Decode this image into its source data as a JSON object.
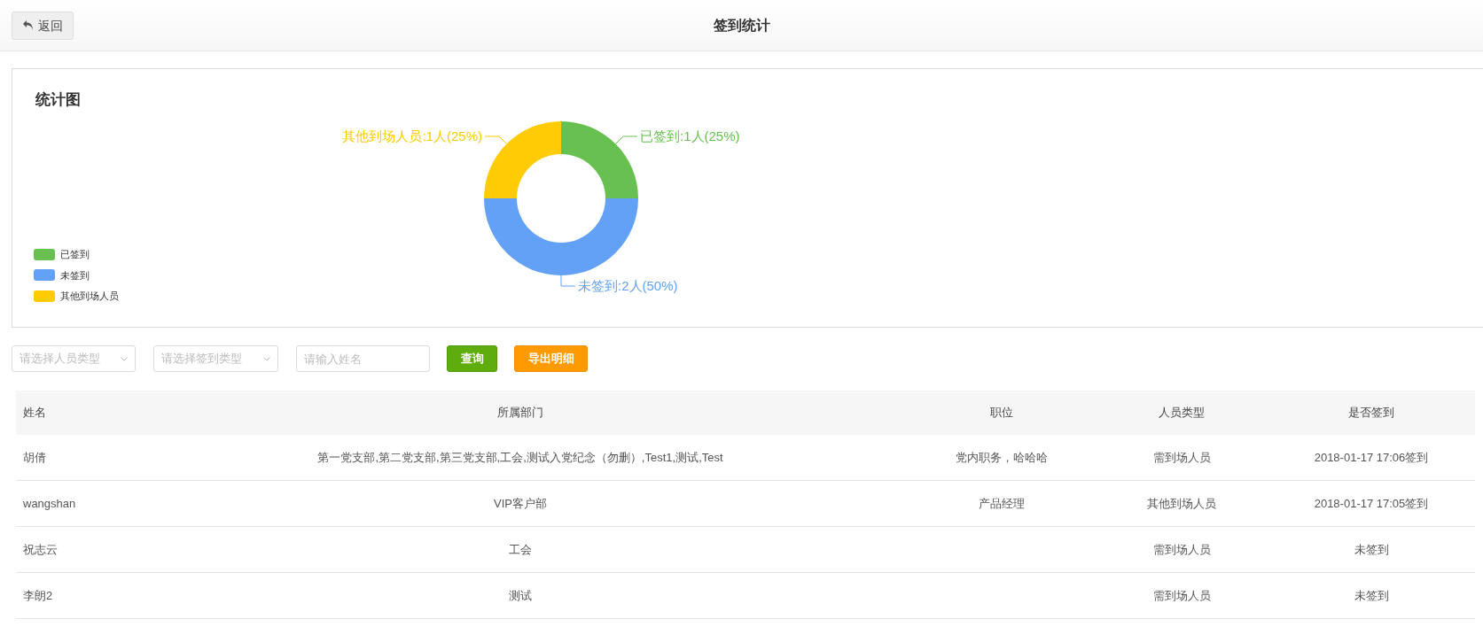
{
  "header": {
    "back_button": "返回",
    "title": "签到统计"
  },
  "chart_panel": {
    "title": "统计图",
    "legend": [
      {
        "label": "已签到",
        "color": "#67c04f"
      },
      {
        "label": "未签到",
        "color": "#62a1f5"
      },
      {
        "label": "其他到场人员",
        "color": "#fecb04"
      }
    ],
    "slice_labels": [
      "已签到:1人(25%)",
      "未签到:2人(50%)",
      "其他到场人员:1人(25%)"
    ],
    "chart_data": {
      "type": "donut",
      "series": [
        {
          "colors": [
            "#67c04f",
            "#62a1f5",
            "#fecb04"
          ],
          "values": [
            25,
            50,
            25
          ]
        }
      ]
    }
  },
  "filters": {
    "person_type": {
      "placeholder": "请选择人员类型"
    },
    "sign_type": {
      "placeholder": "请选择签到类型"
    },
    "name": {
      "placeholder": "请输入姓名"
    },
    "buttons": [
      {
        "kind": "query",
        "label": "查询"
      },
      {
        "kind": "export",
        "label": "导出明细"
      }
    ]
  },
  "table": {
    "columns": [
      "姓名",
      "所属部门",
      "职位",
      "人员类型",
      "是否签到"
    ],
    "rows": [
      [
        "胡倩",
        "第一党支部,第二党支部,第三党支部,工会,测试入党纪念（勿删）,Test1,测试,Test",
        "党内职务，哈哈哈",
        "需到场人员",
        "2018-01-17 17:06签到"
      ],
      [
        "wangshan",
        "VIP客户部",
        "产品经理",
        "其他到场人员",
        "2018-01-17 17:05签到"
      ],
      [
        "祝志云",
        "工会",
        "",
        "需到场人员",
        "未签到"
      ],
      [
        "李朗2",
        "测试",
        "",
        "需到场人员",
        "未签到"
      ]
    ]
  }
}
